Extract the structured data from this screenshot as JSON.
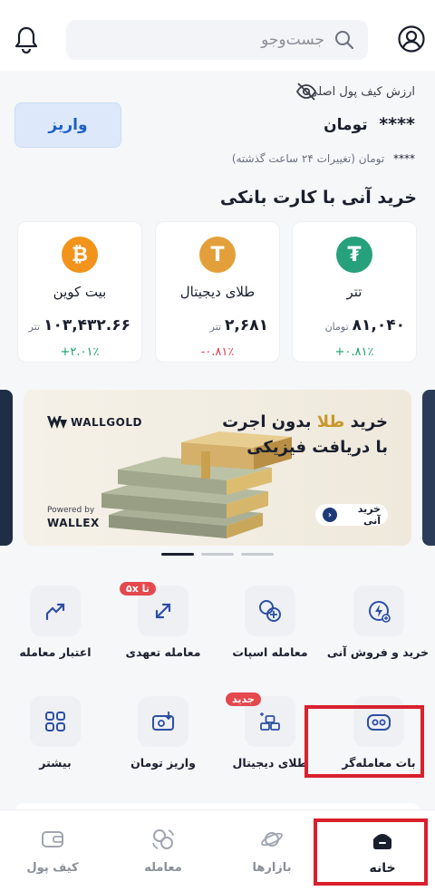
{
  "header": {
    "search_placeholder": "جست‌وجو",
    "notification_icon": "bell-icon",
    "profile_icon": "user-circle-icon"
  },
  "wallet": {
    "label": "ارزش کیف پول اصلی",
    "hide_icon": "eye-off-icon",
    "balance_hidden": "****",
    "balance_unit": "تومان",
    "change_hidden": "****",
    "change_text": "تومان (تغییرات ۲۴ ساعت گذشته)",
    "deposit_label": "واریز"
  },
  "quick_buy": {
    "title": "خرید آنی با کارت بانکی",
    "cards": [
      {
        "name": "تتر",
        "price": "۸۱,۰۴۰",
        "unit": "تومان",
        "change": "+۰.۸۱٪",
        "trend": "pos",
        "icon": "tether-icon",
        "color": "#26a17b",
        "glyph": "₮"
      },
      {
        "name": "طلای دیجیتال",
        "price": "۲,۶۸۱",
        "unit": "تتر",
        "change": "-۰.۸۱٪",
        "trend": "neg",
        "icon": "digital-gold-icon",
        "color": "#e3a03a",
        "glyph": "T"
      },
      {
        "name": "بیت کوین",
        "price": "۱۰۳,۴۳۲.۶۶",
        "unit": "تتر",
        "change": "+۲.۰۱٪",
        "trend": "pos",
        "icon": "bitcoin-icon",
        "color": "#f2931b",
        "glyph": "₿"
      }
    ]
  },
  "banner": {
    "brand": "WALLGOLD",
    "title_line1_pre": "خرید",
    "title_line1_gold": "طلا",
    "title_line1_post": "بدون اجرت",
    "title_line2": "با دریافت فیزیکی",
    "button_label": "خرید آنی",
    "powered_by": "Powered by",
    "powered_brand": "WALLEX",
    "pages": 3,
    "active_page": 1
  },
  "services": {
    "row1": [
      {
        "label": "خرید و فروش آنی",
        "icon": "instant-trade-icon",
        "badge": ""
      },
      {
        "label": "معامله اسپات",
        "icon": "spot-trade-icon",
        "badge": ""
      },
      {
        "label": "معامله تعهدی",
        "icon": "margin-trade-icon",
        "badge": "تا ۵x"
      },
      {
        "label": "اعتبار معامله",
        "icon": "trade-credit-icon",
        "badge": ""
      }
    ],
    "row2": [
      {
        "label": "بات معامله‌گر",
        "icon": "trading-bot-icon",
        "badge": ""
      },
      {
        "label": "طلای دیجیتال",
        "icon": "digital-gold-bars-icon",
        "badge": "جدید"
      },
      {
        "label": "واریز تومان",
        "icon": "toman-deposit-icon",
        "badge": ""
      },
      {
        "label": "بیشتر",
        "icon": "more-grid-icon",
        "badge": ""
      }
    ]
  },
  "bottom_nav": {
    "items": [
      {
        "label": "خانه",
        "icon": "home-icon",
        "active": true
      },
      {
        "label": "بازارها",
        "icon": "markets-planet-icon",
        "active": false
      },
      {
        "label": "معامله",
        "icon": "trade-exchange-icon",
        "active": false
      },
      {
        "label": "کیف پول",
        "icon": "wallet-icon",
        "active": false
      }
    ]
  },
  "colors": {
    "accent_blue": "#1d5fc8",
    "positive": "#1b9e6a",
    "negative": "#d8404a",
    "highlight_red": "#d9202d",
    "gold": "#c9982b"
  }
}
